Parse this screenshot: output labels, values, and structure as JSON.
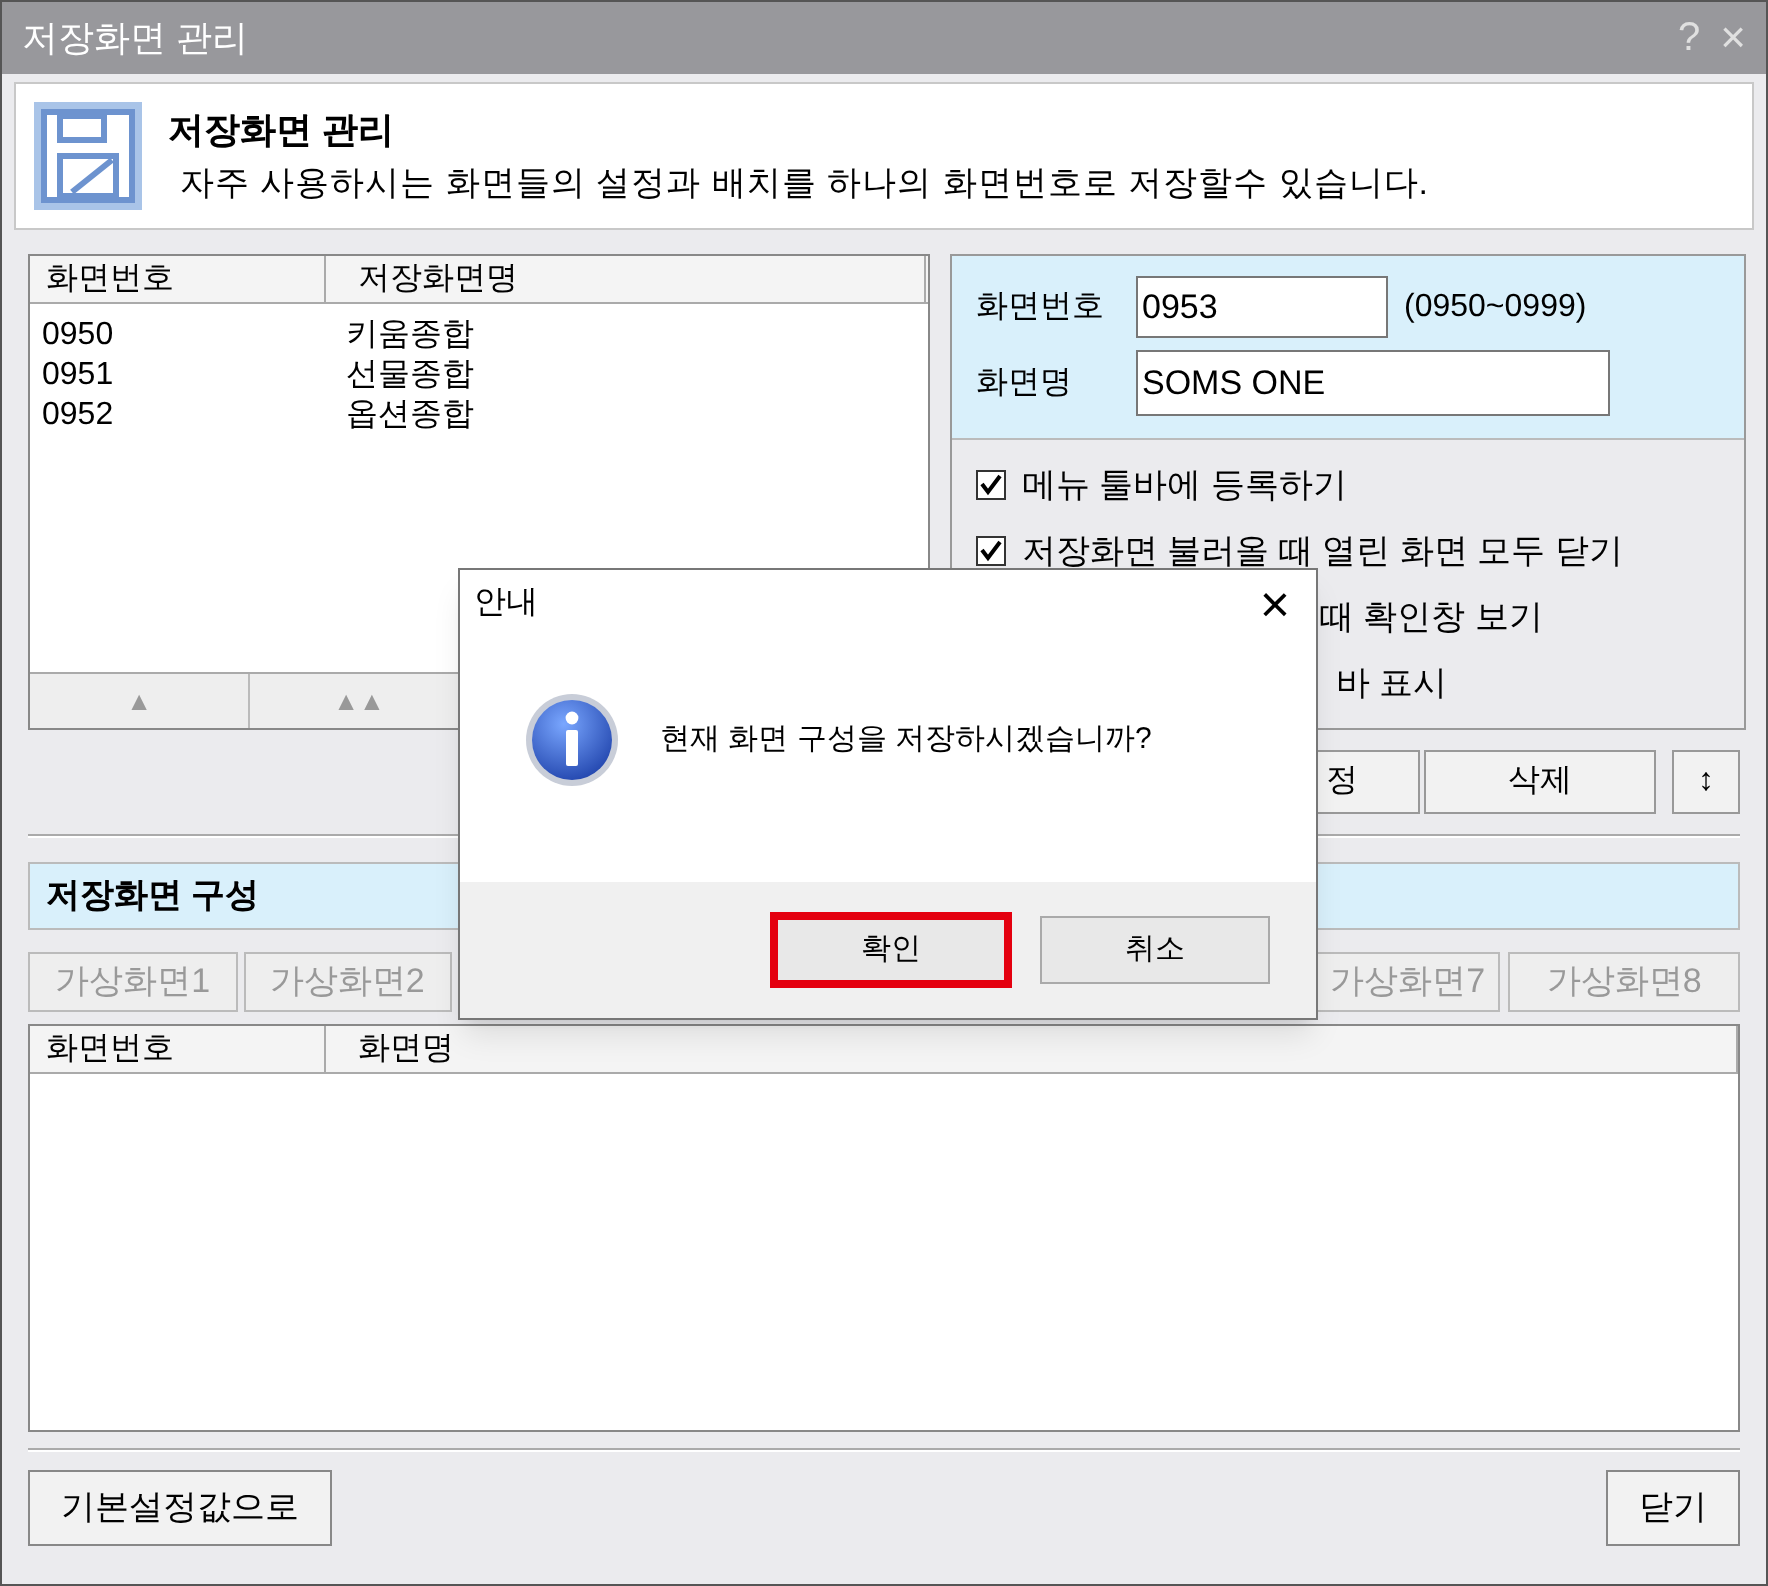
{
  "window": {
    "title": "저장화면 관리",
    "help": "?",
    "close": "×"
  },
  "header": {
    "title": "저장화면 관리",
    "description": "자주 사용하시는 화면들의 설정과 배치를 하나의 화면번호로 저장할수 있습니다."
  },
  "list": {
    "columns": [
      "화면번호",
      "저장화면명"
    ],
    "rows": [
      {
        "number": "0950",
        "name": "키움종합"
      },
      {
        "number": "0951",
        "name": "선물종합"
      },
      {
        "number": "0952",
        "name": "옵션종합"
      }
    ],
    "buttons": [
      "▲",
      "▲▲"
    ]
  },
  "form": {
    "number_label": "화면번호",
    "number_value": "0953",
    "range": "(0950~0999)",
    "name_label": "화면명",
    "name_value": "SOMS ONE"
  },
  "options": [
    {
      "kind": "checkbox",
      "label": "메뉴 툴바에 등록하기",
      "checked": true
    },
    {
      "kind": "checkbox",
      "label": "저장화면 불러올 때 열린 화면 모두 닫기",
      "checked": true
    },
    {
      "kind": "fragment",
      "label": "때 확인창 보기"
    },
    {
      "kind": "fragment",
      "label": "바 표시"
    }
  ],
  "actions": [
    "정",
    "삭제",
    "↕"
  ],
  "layout_section": {
    "title": "저장화면 구성",
    "tabs": [
      {
        "label": "가상화면1"
      },
      {
        "label": "가상화면2"
      },
      {
        "label": "가상화면7"
      },
      {
        "label": "가상화면8"
      }
    ],
    "columns": [
      "화면번호",
      "화면명"
    ]
  },
  "footer": {
    "reset": "기본설정값으로",
    "close": "닫기"
  },
  "dialog": {
    "title": "안내",
    "close": "×",
    "message": "현재 화면 구성을 저장하시겠습니까?",
    "buttons": [
      {
        "label": "확인",
        "selected": true
      },
      {
        "label": "취소",
        "selected": false
      }
    ]
  }
}
